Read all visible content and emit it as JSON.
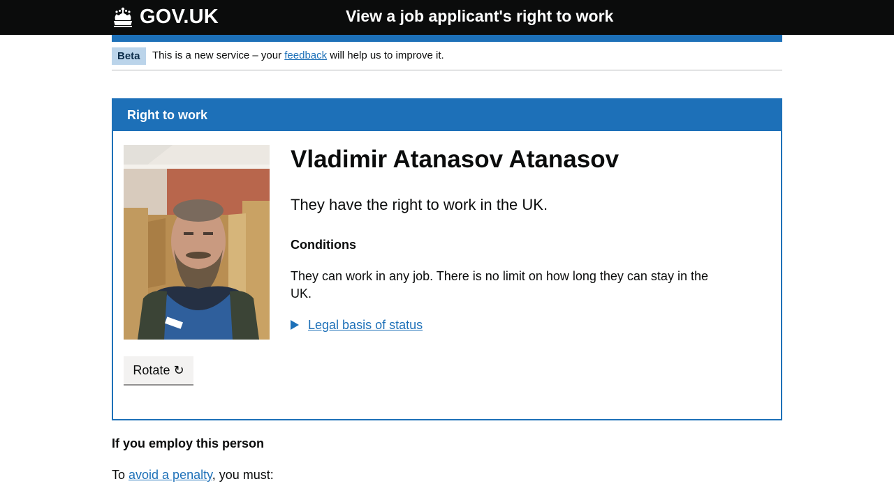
{
  "header": {
    "logo_text": "GOV.UK",
    "service_name": "View a job applicant's right to work"
  },
  "phase_banner": {
    "tag": "Beta",
    "text_before": "This is a new service – your ",
    "link_text": "feedback",
    "text_after": " will help us to improve it."
  },
  "panel": {
    "title": "Right to work",
    "photo_icon": "applicant-photo",
    "rotate_label": "Rotate",
    "rotate_icon": "↻",
    "name": "Vladimir Atanasov Atanasov",
    "status": "They have the right to work in the UK.",
    "conditions_heading": "Conditions",
    "conditions_text": "They can work in any job. There is no limit on how long they can stay in the UK.",
    "details_summary": "Legal basis of status"
  },
  "employ": {
    "heading": "If you employ this person",
    "penalty_before": "To ",
    "penalty_link": "avoid a penalty",
    "penalty_after": ", you must:"
  },
  "colors": {
    "header_bg": "#0b0c0c",
    "brand_blue": "#1d70b8",
    "phase_tag_bg": "#bbd4ea",
    "button_bg": "#f3f2f1"
  }
}
